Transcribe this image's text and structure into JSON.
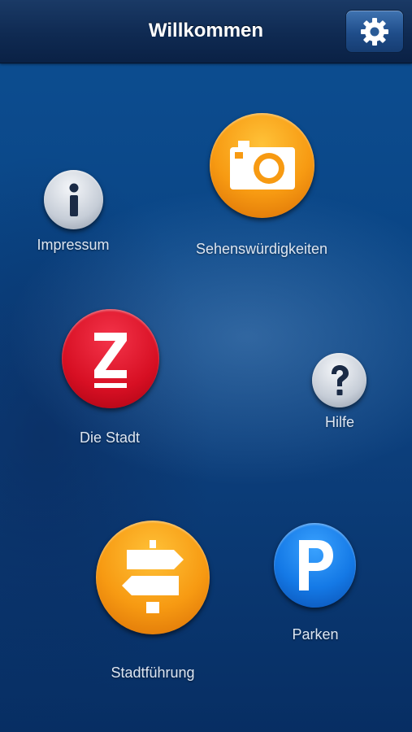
{
  "navbar": {
    "title": "Willkommen",
    "settings_icon": "gear-icon"
  },
  "menu": {
    "impressum": {
      "label": "Impressum",
      "icon": "info-icon"
    },
    "sehenswuerdigkeiten": {
      "label": "Sehenswürdigkeiten",
      "icon": "camera-icon"
    },
    "die_stadt": {
      "label": "Die Stadt",
      "icon": "city-logo-z-icon"
    },
    "hilfe": {
      "label": "Hilfe",
      "icon": "question-mark-icon"
    },
    "stadtfuehrung": {
      "label": "Stadtführung",
      "icon": "signpost-icon"
    },
    "parken": {
      "label": "Parken",
      "icon": "parking-icon"
    }
  },
  "colors": {
    "background": "#0c4a8c",
    "navbar": "#0f2a52",
    "orange": "#f79a12",
    "red": "#d70f23",
    "blue": "#1479e6",
    "grey": "#c6cdd7"
  }
}
